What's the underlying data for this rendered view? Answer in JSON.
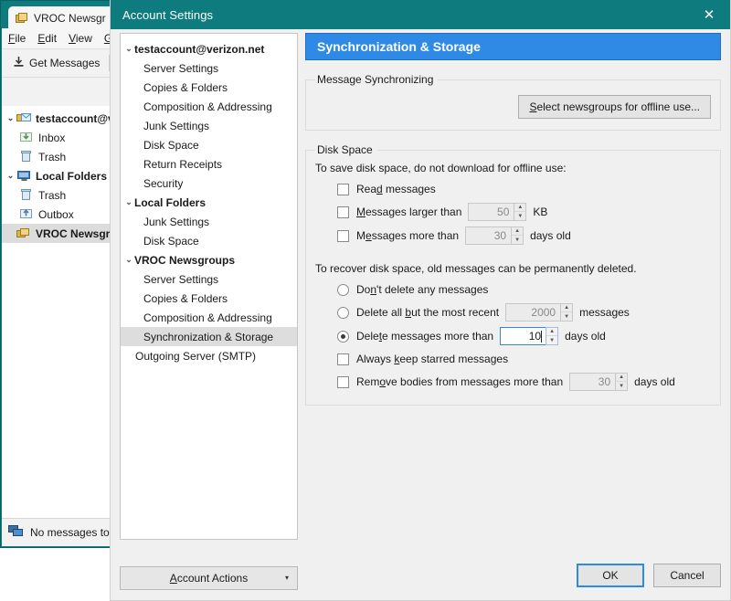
{
  "background_window": {
    "tab": {
      "label": "VROC Newsgr",
      "icon": "newsgroup-icon"
    },
    "menubar": [
      "File",
      "Edit",
      "View",
      "Go"
    ],
    "toolbar": {
      "get_messages_label": "Get Messages",
      "dropdown_caret": "▾"
    },
    "folder_tree": [
      {
        "label": "testaccount@ve",
        "icon": "mail-account-icon",
        "depth": 0,
        "bold": true,
        "twisty": "⌄",
        "selected": false
      },
      {
        "label": "Inbox",
        "icon": "inbox-icon",
        "depth": 1,
        "bold": false,
        "twisty": "",
        "selected": false
      },
      {
        "label": "Trash",
        "icon": "trash-icon",
        "depth": 1,
        "bold": false,
        "twisty": "",
        "selected": false
      },
      {
        "label": "Local Folders",
        "icon": "local-folders-icon",
        "depth": 0,
        "bold": true,
        "twisty": "⌄",
        "selected": false
      },
      {
        "label": "Trash",
        "icon": "trash-icon",
        "depth": 1,
        "bold": false,
        "twisty": "",
        "selected": false
      },
      {
        "label": "Outbox",
        "icon": "outbox-icon",
        "depth": 1,
        "bold": false,
        "twisty": "",
        "selected": false
      },
      {
        "label": "VROC Newsgro",
        "icon": "newsgroup-icon",
        "depth": 0,
        "bold": true,
        "twisty": "",
        "selected": true
      }
    ],
    "status_text": "No messages to "
  },
  "dialog": {
    "title": "Account Settings",
    "close_label": "✕",
    "tree": [
      {
        "label": "testaccount@verizon.net",
        "type": "group",
        "twisty": "⌄",
        "selected": false
      },
      {
        "label": "Server Settings",
        "type": "leaf",
        "twisty": "",
        "selected": false
      },
      {
        "label": "Copies & Folders",
        "type": "leaf",
        "twisty": "",
        "selected": false
      },
      {
        "label": "Composition & Addressing",
        "type": "leaf",
        "twisty": "",
        "selected": false
      },
      {
        "label": "Junk Settings",
        "type": "leaf",
        "twisty": "",
        "selected": false
      },
      {
        "label": "Disk Space",
        "type": "leaf",
        "twisty": "",
        "selected": false
      },
      {
        "label": "Return Receipts",
        "type": "leaf",
        "twisty": "",
        "selected": false
      },
      {
        "label": "Security",
        "type": "leaf",
        "twisty": "",
        "selected": false
      },
      {
        "label": "Local Folders",
        "type": "group",
        "twisty": "⌄",
        "selected": false
      },
      {
        "label": "Junk Settings",
        "type": "leaf",
        "twisty": "",
        "selected": false
      },
      {
        "label": "Disk Space",
        "type": "leaf",
        "twisty": "",
        "selected": false
      },
      {
        "label": "VROC Newsgroups",
        "type": "group",
        "twisty": "⌄",
        "selected": false
      },
      {
        "label": "Server Settings",
        "type": "leaf",
        "twisty": "",
        "selected": false
      },
      {
        "label": "Copies & Folders",
        "type": "leaf",
        "twisty": "",
        "selected": false
      },
      {
        "label": "Composition & Addressing",
        "type": "leaf",
        "twisty": "",
        "selected": false
      },
      {
        "label": "Synchronization & Storage",
        "type": "leaf",
        "twisty": "",
        "selected": true
      },
      {
        "label": "Outgoing Server (SMTP)",
        "type": "leaf-top",
        "twisty": "",
        "selected": false
      }
    ],
    "account_actions": {
      "label": "Account Actions",
      "caret": "▾"
    },
    "panel": {
      "header": "Synchronization & Storage",
      "message_sync": {
        "legend": "Message Synchronizing",
        "select_newsgroups_button": "Select newsgroups for offline use..."
      },
      "disk_space": {
        "legend": "Disk Space",
        "save_intro": "To save disk space, do not download for offline use:",
        "read_messages": {
          "label": "Read messages",
          "checked": false
        },
        "messages_larger_than": {
          "label": "Messages larger than",
          "checked": false,
          "value": "50",
          "unit": "KB"
        },
        "messages_more_than": {
          "label": "Messages more than",
          "checked": false,
          "value": "30",
          "unit": "days old"
        },
        "recover_intro": "To recover disk space, old messages can be permanently deleted.",
        "dont_delete": {
          "label": "Don't delete any messages",
          "selected": false
        },
        "delete_all_but": {
          "label": "Delete all but the most recent",
          "selected": false,
          "value": "2000",
          "unit": "messages"
        },
        "delete_more_than": {
          "label": "Delete messages more than",
          "selected": true,
          "value": "10",
          "unit": "days old",
          "focused": true
        },
        "keep_starred": {
          "label": "Always keep starred messages",
          "checked": false
        },
        "remove_bodies": {
          "label": "Remove bodies from messages more than",
          "checked": false,
          "value": "30",
          "unit": "days old"
        }
      }
    },
    "footer": {
      "ok": "OK",
      "cancel": "Cancel"
    }
  },
  "colors": {
    "titlebar": "#0e7b7e",
    "panel_header": "#2e8ae5",
    "dialog_bg": "#f0f0f0",
    "selection": "#dddddd",
    "focus_border": "#2e8ae5"
  }
}
